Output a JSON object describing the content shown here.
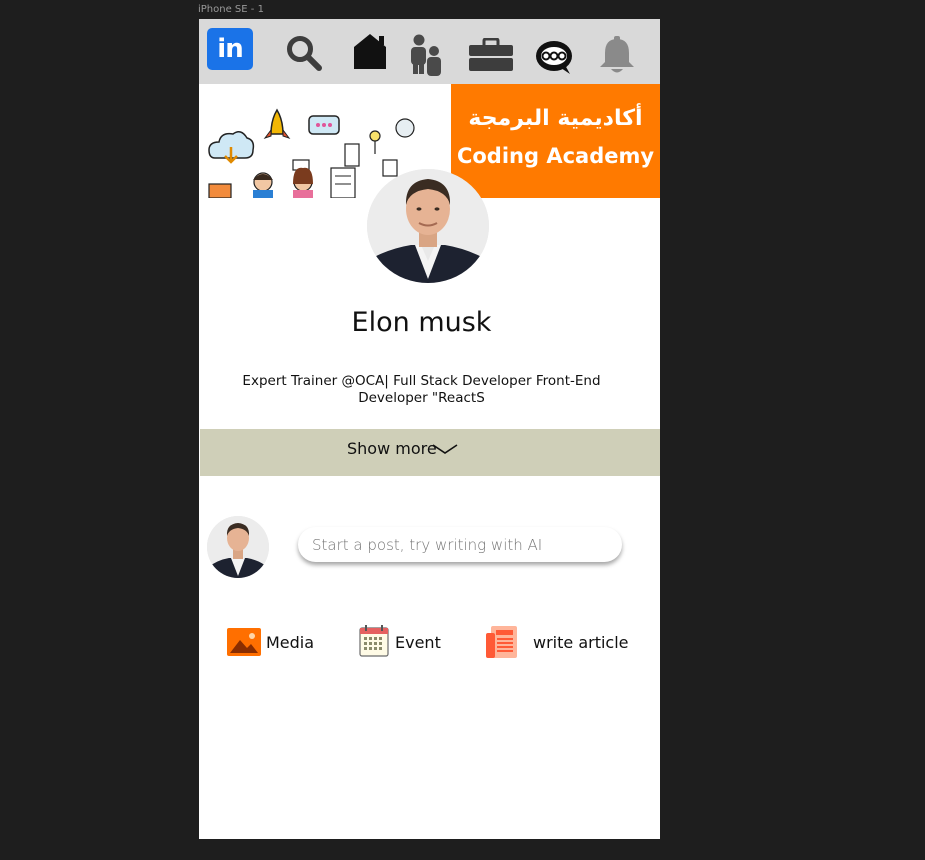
{
  "frame": {
    "label": "iPhone SE - 1"
  },
  "nav": {
    "logo_text": "in",
    "icons": [
      "linkedin-logo",
      "search-icon",
      "home-icon",
      "network-icon",
      "jobs-briefcase-icon",
      "messaging-icon",
      "notifications-bell-icon"
    ]
  },
  "banner": {
    "arabic_text": "أكاديمية البرمجة",
    "english_text": "Coding Academy",
    "accent_color": "#ff7a00"
  },
  "profile": {
    "name": "Elon musk",
    "headline_line1": "Expert Trainer @OCA| Full Stack Developer Front-End",
    "headline_line2": "Developer \"ReactS"
  },
  "show_more": {
    "label": "Show more"
  },
  "composer": {
    "placeholder": "Start a post, try writing with AI"
  },
  "actions": {
    "media": "Media",
    "event": "Event",
    "article": "write article"
  },
  "colors": {
    "nav_bg": "#d9d9d9",
    "linkedin_blue": "#1a73e8",
    "show_more_bg": "#cfcfb8",
    "canvas_bg": "#1e1e1e"
  }
}
